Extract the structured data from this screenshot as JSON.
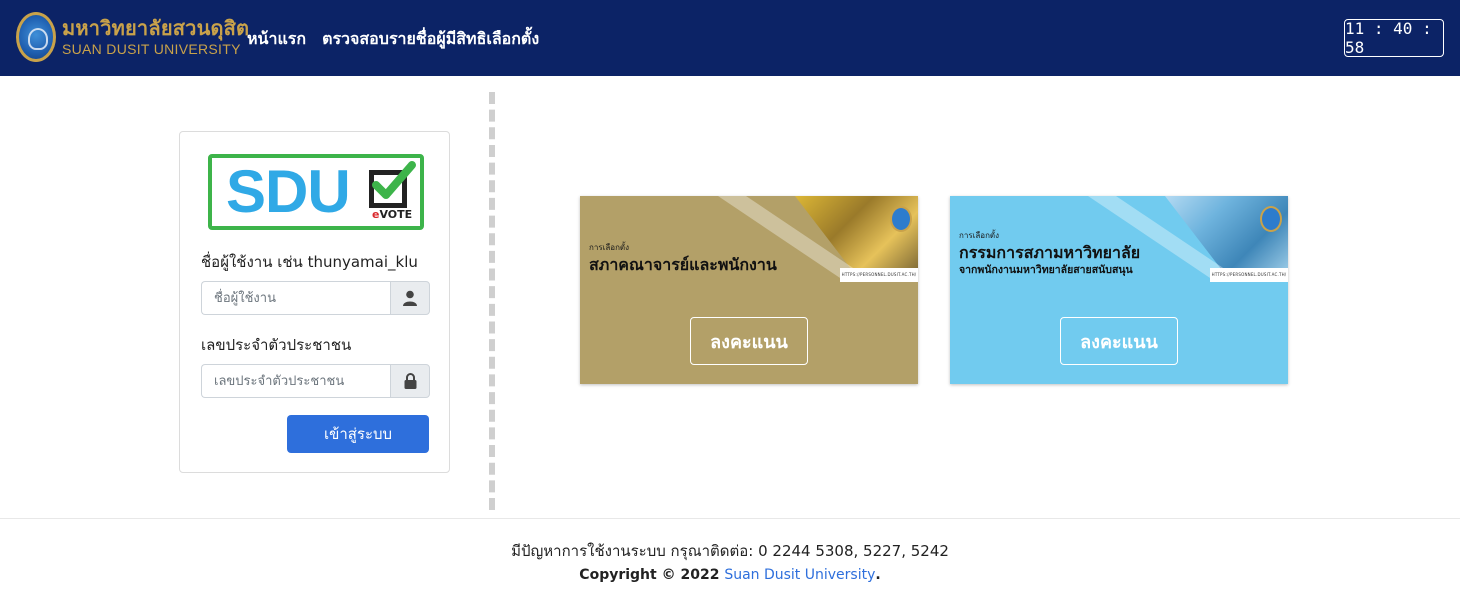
{
  "header": {
    "brand_th": "มหาวิทยาลัยสวนดุสิต",
    "brand_en": "SUAN DUSIT UNIVERSITY",
    "nav": [
      {
        "label": "หน้าแรก"
      },
      {
        "label": "ตรวจสอบรายชื่อผู้มีสิทธิเลือกตั้ง"
      }
    ],
    "clock": "11 : 40 : 58"
  },
  "login": {
    "logo_text": "SDU",
    "logo_evote": "eVOTE",
    "username_label": "ชื่อผู้ใช้งาน เช่น thunyamai_klu",
    "username_placeholder": "ชื่อผู้ใช้งาน",
    "id_label": "เลขประจำตัวประชาชน",
    "id_placeholder": "เลขประจำตัวประชาชน",
    "submit_label": "เข้าสู่ระบบ"
  },
  "elections": [
    {
      "small": "การเลือกตั้ง",
      "title": "สภาคณาจารย์และพนักงาน",
      "subtitle": "",
      "url": "HTTPS://PERSONNEL.DUSIT.AC.TH/",
      "vote_label": "ลงคะแนน",
      "color": "#b3a068"
    },
    {
      "small": "การเลือกตั้ง",
      "title": "กรรมการสภามหาวิทยาลัย",
      "subtitle": "จากพนักงานมหาวิทยาลัยสายสนับสนุน",
      "url": "HTTPS://PERSONNEL.DUSIT.AC.TH/",
      "vote_label": "ลงคะแนน",
      "color": "#71cbef"
    }
  ],
  "footer": {
    "contact": "มีปัญหาการใช้งานระบบ กรุณาติดต่อ: 0 2244 5308, 5227, 5242",
    "copyright": "Copyright © 2022 ",
    "university_link": "Suan Dusit University",
    "period": "."
  },
  "colors": {
    "navbar": "#0c2366",
    "brand_gold": "#c9a24a",
    "primary": "#2e6fdc",
    "logo_blue": "#30a9e6",
    "logo_green": "#3db44a"
  }
}
